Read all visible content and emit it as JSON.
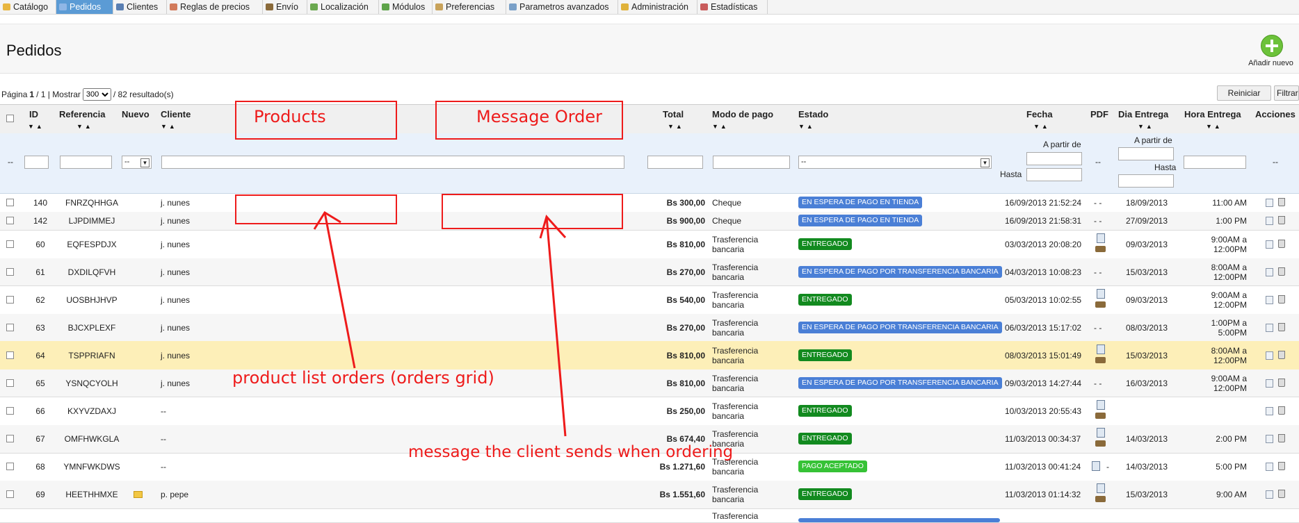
{
  "menu": {
    "tabs": [
      {
        "label": "Catálogo",
        "icon": "folder-icon",
        "color": "#e8b640"
      },
      {
        "label": "Pedidos",
        "icon": "cart-icon",
        "color": "#8fb6e6",
        "active": true
      },
      {
        "label": "Clientes",
        "icon": "users-icon",
        "color": "#5a7fb2"
      },
      {
        "label": "Reglas de precios",
        "icon": "tag-icon",
        "color": "#d27a5a"
      },
      {
        "label": "Envío",
        "icon": "truck-icon",
        "color": "#8a6a3a"
      },
      {
        "label": "Localización",
        "icon": "globe-icon",
        "color": "#6aa84f"
      },
      {
        "label": "Módulos",
        "icon": "puzzle-icon",
        "color": "#5ea34a"
      },
      {
        "label": "Preferencias",
        "icon": "settings-icon",
        "color": "#c8a25a"
      },
      {
        "label": "Parametros avanzados",
        "icon": "wrench-icon",
        "color": "#7aa0c8"
      },
      {
        "label": "Administración",
        "icon": "key-icon",
        "color": "#e0b23a"
      },
      {
        "label": "Estadísticas",
        "icon": "chart-icon",
        "color": "#c85a5a"
      }
    ]
  },
  "header": {
    "title": "Pedidos",
    "add_new": "Añadir nuevo"
  },
  "pager": {
    "prefix": "Página",
    "current": "1",
    "sep": "/ 1 | Mostrar",
    "per_page": "300",
    "results": "/ 82 resultado(s)"
  },
  "buttons": {
    "reset": "Reiniciar",
    "filter": "Filtrar"
  },
  "columns": {
    "id": "ID",
    "reference": "Referencia",
    "new": "Nuevo",
    "customer": "Cliente",
    "total": "Total",
    "payment": "Modo de pago",
    "status": "Estado",
    "date": "Fecha",
    "pdf": "PDF",
    "delivery_day": "Dia Entrega",
    "delivery_time": "Hora Entrega",
    "actions": "Acciones"
  },
  "filters": {
    "dash": "--",
    "new_select": "--",
    "status_select": "--",
    "from": "A partir de",
    "to": "Hasta",
    "pdf": "--",
    "actions": "--"
  },
  "status_colors": {
    "en_espera_tienda": "#4a7fd6",
    "en_espera_transferencia": "#4a7fd6",
    "entregado": "#128a1f",
    "pago_aceptado": "#36c236"
  },
  "rows": [
    {
      "id": "140",
      "ref": "FNRZQHHGA",
      "customer": "j. nunes",
      "total": "Bs 300,00",
      "payment": "Cheque",
      "status": "EN ESPERA DE PAGO EN TIENDA",
      "status_kind": "en_espera_tienda",
      "date": "16/09/2013 21:52:24",
      "pdf": "- -",
      "day": "18/09/2013",
      "time": "11:00 AM"
    },
    {
      "id": "142",
      "ref": "LJPDIMMEJ",
      "customer": "j. nunes",
      "total": "Bs 900,00",
      "payment": "Cheque",
      "status": "EN ESPERA DE PAGO EN TIENDA",
      "status_kind": "en_espera_tienda",
      "date": "16/09/2013 21:58:31",
      "pdf": "- -",
      "day": "27/09/2013",
      "time": "1:00 PM"
    },
    {
      "id": "60",
      "ref": "EQFESPDJX",
      "customer": "j. nunes",
      "total": "Bs 810,00",
      "payment": "Trasferencia bancaria",
      "status": "ENTREGADO",
      "status_kind": "entregado",
      "date": "03/03/2013 20:08:20",
      "pdf": "icons",
      "day": "09/03/2013",
      "time": "9:00AM a 12:00PM"
    },
    {
      "id": "61",
      "ref": "DXDILQFVH",
      "customer": "j. nunes",
      "total": "Bs 270,00",
      "payment": "Trasferencia bancaria",
      "status": "EN ESPERA DE PAGO POR TRANSFERENCIA BANCARIA",
      "status_kind": "en_espera_transferencia",
      "date": "04/03/2013 10:08:23",
      "pdf": "- -",
      "day": "15/03/2013",
      "time": "8:00AM a 12:00PM"
    },
    {
      "id": "62",
      "ref": "UOSBHJHVP",
      "customer": "j. nunes",
      "total": "Bs 540,00",
      "payment": "Trasferencia bancaria",
      "status": "ENTREGADO",
      "status_kind": "entregado",
      "date": "05/03/2013 10:02:55",
      "pdf": "icons",
      "day": "09/03/2013",
      "time": "9:00AM a 12:00PM"
    },
    {
      "id": "63",
      "ref": "BJCXPLEXF",
      "customer": "j. nunes",
      "total": "Bs 270,00",
      "payment": "Trasferencia bancaria",
      "status": "EN ESPERA DE PAGO POR TRANSFERENCIA BANCARIA",
      "status_kind": "en_espera_transferencia",
      "date": "06/03/2013 15:17:02",
      "pdf": "- -",
      "day": "08/03/2013",
      "time": "1:00PM a 5:00PM"
    },
    {
      "id": "64",
      "ref": "TSPPRIAFN",
      "customer": "j. nunes",
      "total": "Bs 810,00",
      "payment": "Trasferencia bancaria",
      "status": "ENTREGADO",
      "status_kind": "entregado",
      "date": "08/03/2013 15:01:49",
      "pdf": "icons",
      "day": "15/03/2013",
      "time": "8:00AM a 12:00PM",
      "highlight": true
    },
    {
      "id": "65",
      "ref": "YSNQCYOLH",
      "customer": "j. nunes",
      "total": "Bs 810,00",
      "payment": "Trasferencia bancaria",
      "status": "EN ESPERA DE PAGO POR TRANSFERENCIA BANCARIA",
      "status_kind": "en_espera_transferencia",
      "date": "09/03/2013 14:27:44",
      "pdf": "- -",
      "day": "16/03/2013",
      "time": "9:00AM a 12:00PM"
    },
    {
      "id": "66",
      "ref": "KXYVZDAXJ",
      "customer": "--",
      "total": "Bs 250,00",
      "payment": "Trasferencia bancaria",
      "status": "ENTREGADO",
      "status_kind": "entregado",
      "date": "10/03/2013 20:55:43",
      "pdf": "icons",
      "day": "",
      "time": ""
    },
    {
      "id": "67",
      "ref": "OMFHWKGLA",
      "customer": "--",
      "total": "Bs 674,40",
      "payment": "Trasferencia bancaria",
      "status": "ENTREGADO",
      "status_kind": "entregado",
      "date": "11/03/2013 00:34:37",
      "pdf": "icons",
      "day": "14/03/2013",
      "time": "2:00 PM"
    },
    {
      "id": "68",
      "ref": "YMNFWKDWS",
      "customer": "--",
      "total": "Bs 1.271,60",
      "payment": "Trasferencia bancaria",
      "status": "PAGO ACEPTADO",
      "status_kind": "pago_aceptado",
      "date": "11/03/2013 00:41:24",
      "pdf": "icon-dash",
      "day": "14/03/2013",
      "time": "5:00 PM"
    },
    {
      "id": "69",
      "ref": "HEETHHMXE",
      "customer": "p. pepe",
      "total": "Bs 1.551,60",
      "payment": "Trasferencia bancaria",
      "status": "ENTREGADO",
      "status_kind": "entregado",
      "date": "11/03/2013 01:14:32",
      "pdf": "icons",
      "day": "15/03/2013",
      "time": "9:00 AM",
      "has_message": true
    },
    {
      "id": "",
      "ref": "",
      "customer": "",
      "total": "",
      "payment": "Trasferencia",
      "status": "",
      "status_kind": "en_espera_transferencia",
      "date": "",
      "pdf": "",
      "day": "",
      "time": "",
      "partial": true
    }
  ],
  "annotations": {
    "products_label": "Products",
    "message_label": "Message Order",
    "products_note": "product list orders (orders grid)",
    "message_note": "message the client sends when ordering"
  }
}
